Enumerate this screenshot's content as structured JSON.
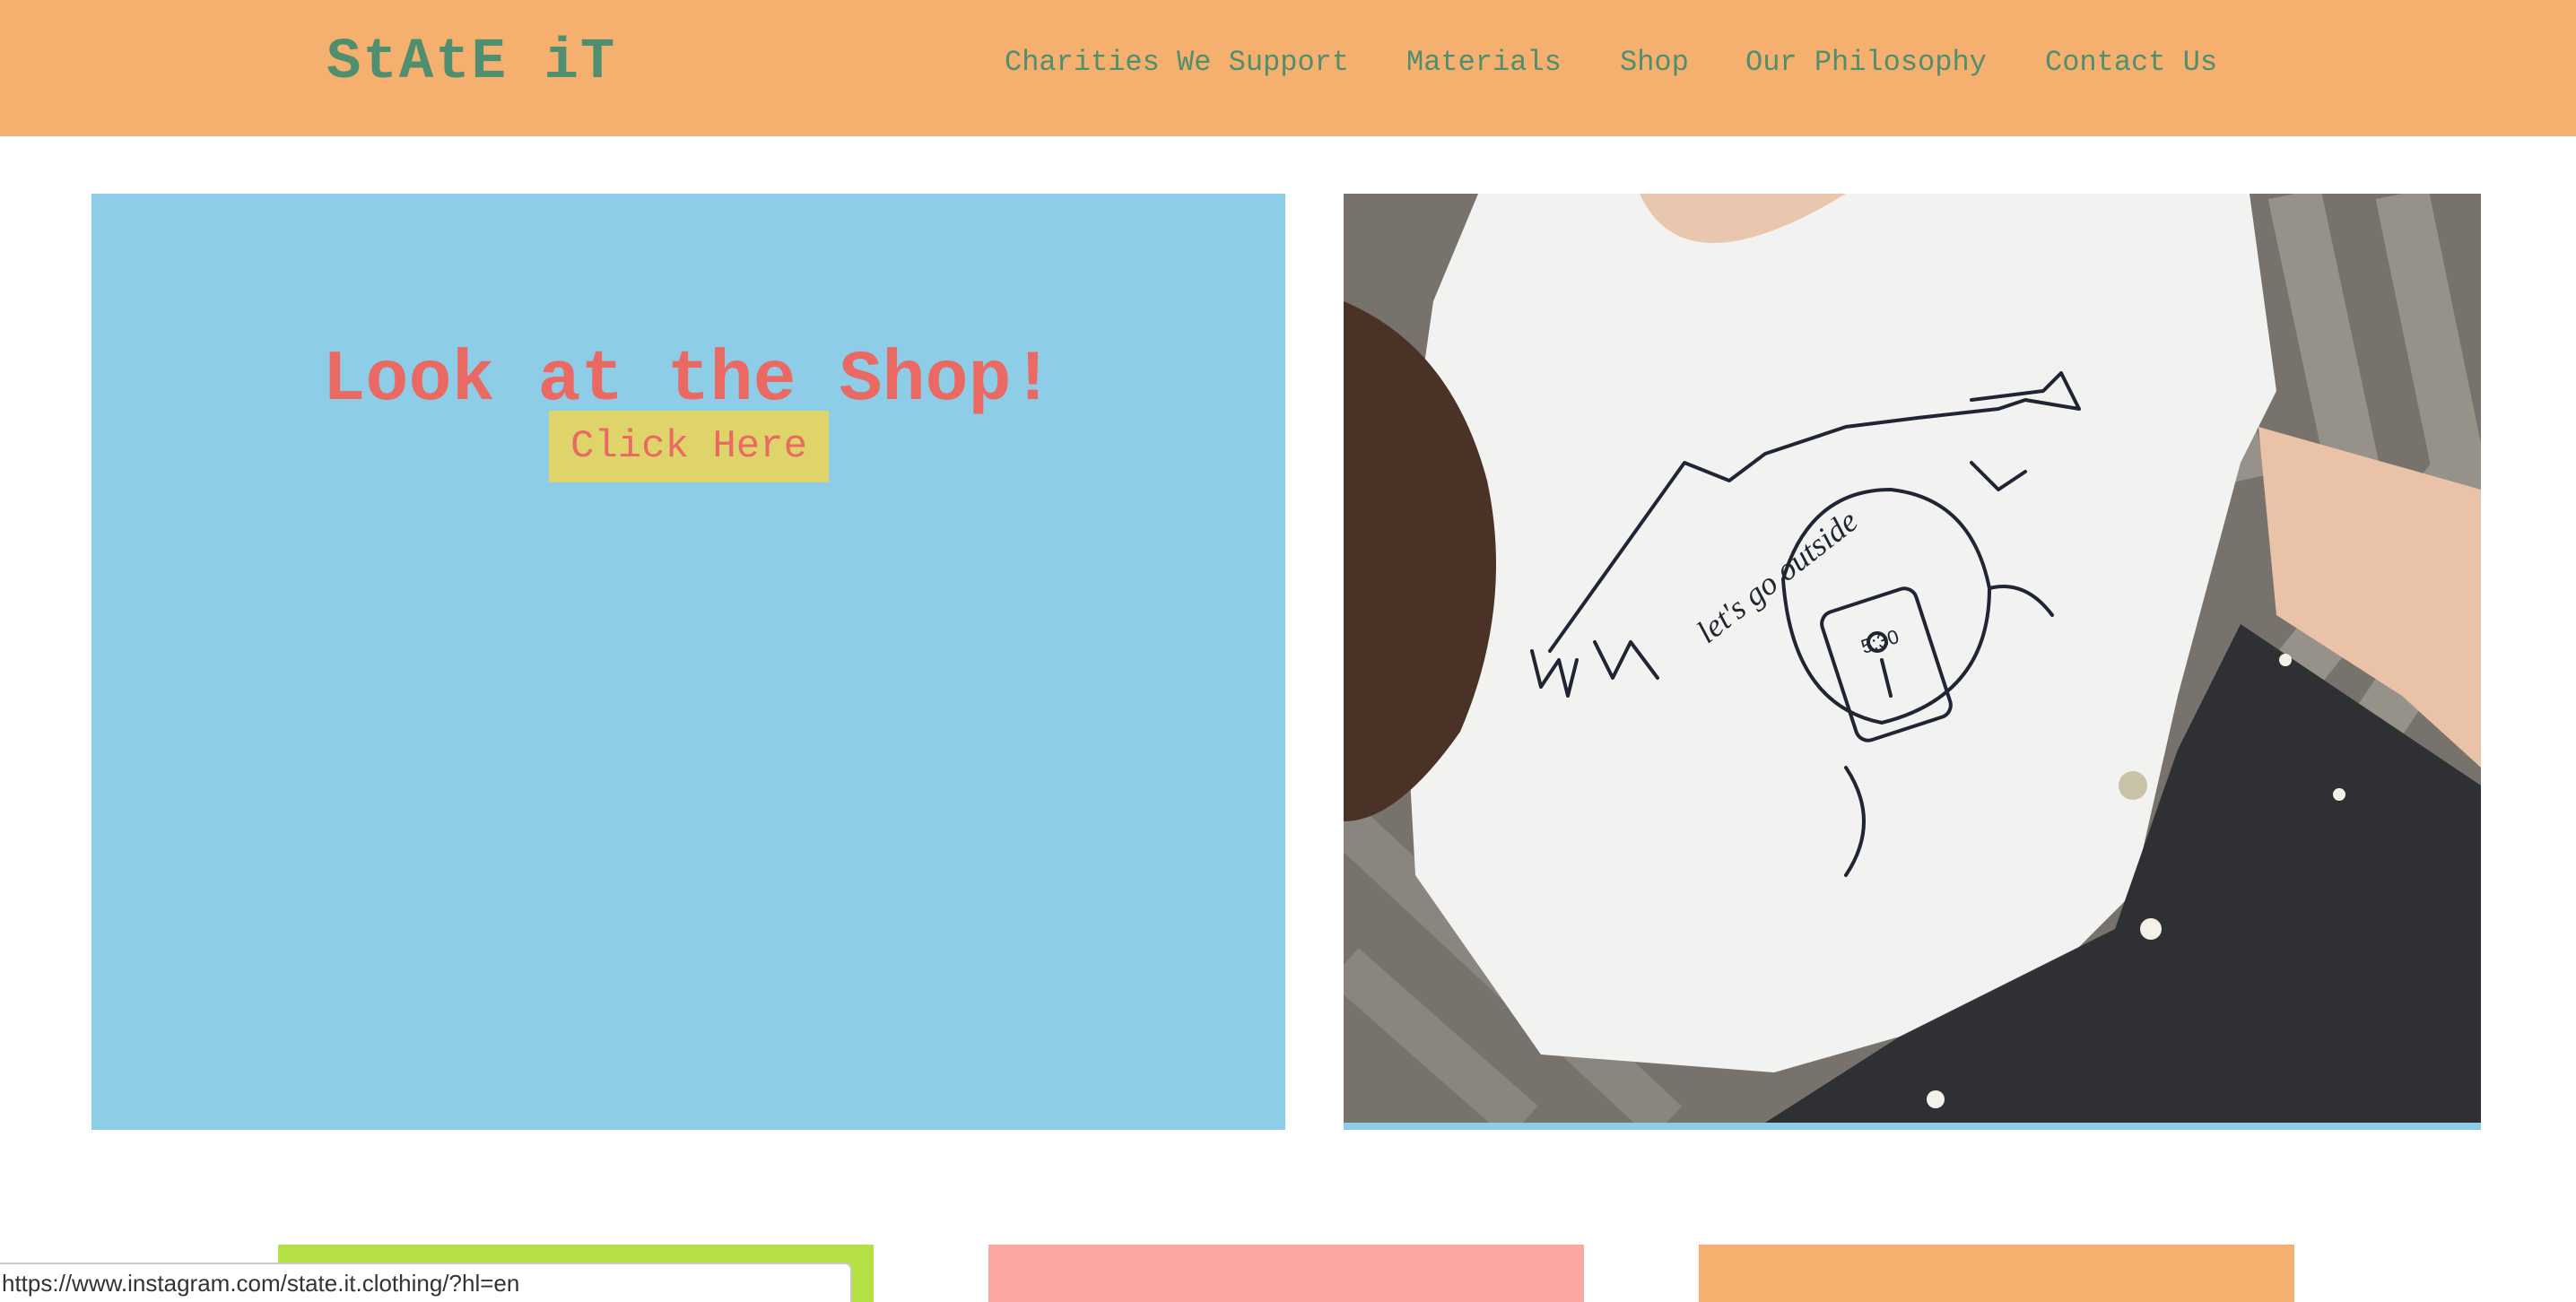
{
  "header": {
    "logo": "StAtE iT",
    "nav": [
      {
        "id": "charities",
        "label": "Charities We Support"
      },
      {
        "id": "materials",
        "label": "Materials"
      },
      {
        "id": "shop",
        "label": "Shop"
      },
      {
        "id": "philosophy",
        "label": "Our Philosophy"
      },
      {
        "id": "contact",
        "label": "Contact Us"
      }
    ]
  },
  "hero": {
    "title": "Look at the Shop!",
    "cta_label": "Click Here",
    "shirt_text": "let's go outside",
    "phone_time": "5:30"
  },
  "status_bar": {
    "url": "https://www.instagram.com/state.it.clothing/?hl=en"
  },
  "colors": {
    "header_bg": "#f5af6e",
    "brand_green": "#4f8f6f",
    "hero_blue": "#8ecde8",
    "accent_red": "#ea6a63",
    "button_yellow": "#dfd46a",
    "card_green": "#b5e043",
    "card_pink": "#fba8a0",
    "card_orange": "#f5af6e"
  }
}
